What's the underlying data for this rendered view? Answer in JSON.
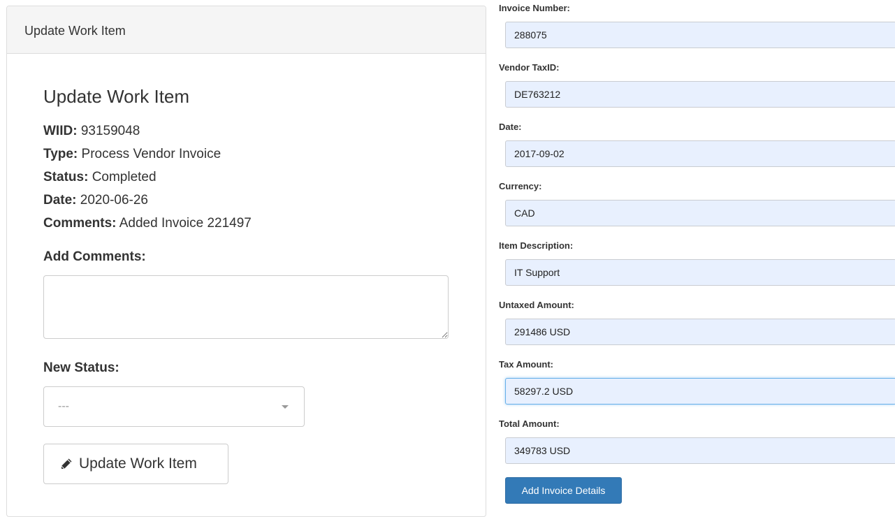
{
  "panel": {
    "heading": "Update Work Item",
    "title": "Update Work Item",
    "info": [
      {
        "label": "WIID:",
        "value": "93159048"
      },
      {
        "label": "Type:",
        "value": "Process Vendor Invoice"
      },
      {
        "label": "Status:",
        "value": "Completed"
      },
      {
        "label": "Date:",
        "value": "2020-06-26"
      },
      {
        "label": "Comments:",
        "value": "Added Invoice 221497"
      }
    ],
    "add_comments_label": "Add Comments:",
    "comments_value": "",
    "new_status_label": "New Status:",
    "status_selected": "---",
    "update_button_label": "Update Work Item",
    "update_button_icon": "pencil-icon"
  },
  "invoice": {
    "fields": [
      {
        "label": "Invoice Number:",
        "value": "288075"
      },
      {
        "label": "Vendor TaxID:",
        "value": "DE763212"
      },
      {
        "label": "Date:",
        "value": "2017-09-02"
      },
      {
        "label": "Currency:",
        "value": "CAD"
      },
      {
        "label": "Item Description:",
        "value": "IT Support"
      },
      {
        "label": "Untaxed Amount:",
        "value": "291486 USD"
      },
      {
        "label": "Tax Amount:",
        "value": "58297.2 USD"
      },
      {
        "label": "Total Amount:",
        "value": "349783 USD"
      }
    ],
    "submit_label": "Add Invoice Details"
  },
  "colors": {
    "primary": "#337ab7",
    "autofill_bg": "#e8f0fe",
    "panel_heading_bg": "#f5f5f5"
  }
}
